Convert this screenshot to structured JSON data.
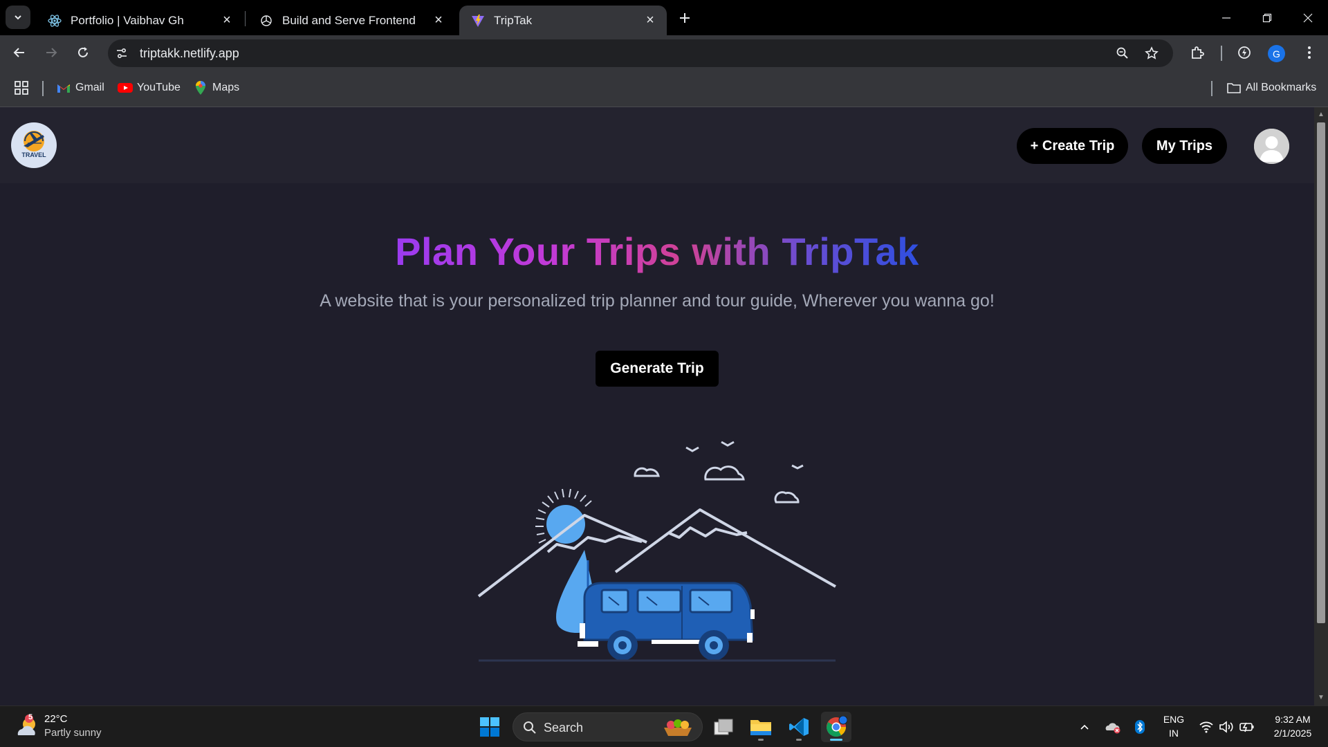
{
  "browser": {
    "tabs": [
      {
        "title": "Portfolio | Vaibhav Gh",
        "icon": "react-icon",
        "active": false
      },
      {
        "title": "Build and Serve Frontend",
        "icon": "openai-icon",
        "active": false
      },
      {
        "title": "TripTak",
        "icon": "vite-icon",
        "active": true
      }
    ],
    "url": "triptakk.netlify.app",
    "profile_initial": "G",
    "bookmarks": [
      {
        "label": "Gmail",
        "icon": "gmail-icon"
      },
      {
        "label": "YouTube",
        "icon": "youtube-icon"
      },
      {
        "label": "Maps",
        "icon": "maps-icon"
      }
    ],
    "all_bookmarks_label": "All Bookmarks"
  },
  "page": {
    "logo_text": "TRAVEL",
    "nav": {
      "create_trip": "+ Create Trip",
      "my_trips": "My Trips"
    },
    "hero": {
      "title": "Plan Your Trips with TripTak",
      "subtitle": "A website that is your personalized trip planner and tour guide, Wherever you wanna go!",
      "cta": "Generate Trip"
    },
    "colors": {
      "background": "#1f1e2b",
      "header": "#24232f",
      "title_gradient_start": "#9b3bf0",
      "title_gradient_end": "#2e4fe0",
      "van": "#1f5fb5"
    }
  },
  "taskbar": {
    "weather": {
      "temp": "22°C",
      "condition": "Partly sunny",
      "badge": "5"
    },
    "search_label": "Search",
    "language": {
      "line1": "ENG",
      "line2": "IN"
    },
    "clock": {
      "time": "9:32 AM",
      "date": "2/1/2025"
    }
  }
}
